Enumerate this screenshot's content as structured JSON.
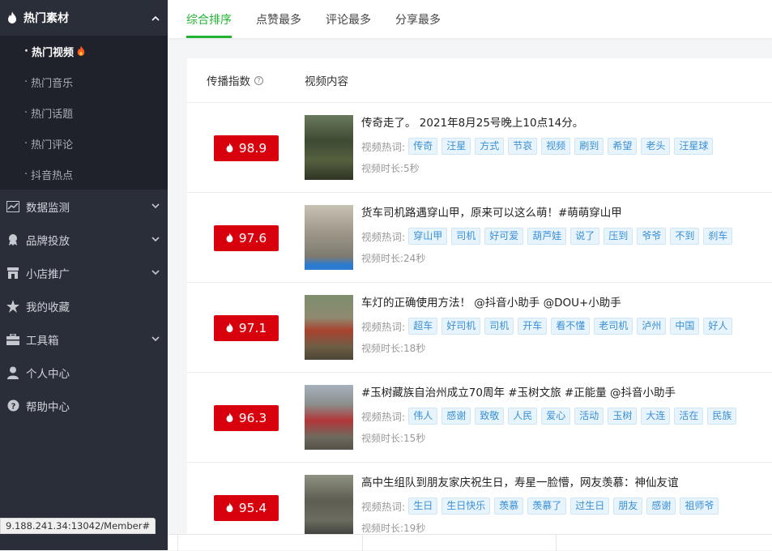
{
  "sidebar": {
    "section": {
      "label": "热门素材"
    },
    "sub_items": [
      {
        "label": "热门视频",
        "active": true
      },
      {
        "label": "热门音乐",
        "active": false
      },
      {
        "label": "热门话题",
        "active": false
      },
      {
        "label": "热门评论",
        "active": false
      },
      {
        "label": "抖音热点",
        "active": false
      }
    ],
    "menu_items": [
      {
        "label": "数据监测",
        "icon": "chart-icon",
        "expandable": true
      },
      {
        "label": "品牌投放",
        "icon": "award-icon",
        "expandable": true
      },
      {
        "label": "小店推广",
        "icon": "shop-icon",
        "expandable": true
      },
      {
        "label": "我的收藏",
        "icon": "star-icon",
        "expandable": false
      },
      {
        "label": "工具箱",
        "icon": "toolbox-icon",
        "expandable": true
      },
      {
        "label": "个人中心",
        "icon": "user-icon",
        "expandable": false
      },
      {
        "label": "帮助中心",
        "icon": "help-icon",
        "expandable": false
      }
    ]
  },
  "status_url": "9.188.241.34:13042/Member#",
  "tabs": [
    "综合排序",
    "点赞最多",
    "评论最多",
    "分享最多"
  ],
  "table": {
    "col_score": "传播指数",
    "col_content": "视频内容",
    "tags_label": "视频热词:",
    "duration_label": "视频时长:",
    "rows": [
      {
        "score": "98.9",
        "title": "传奇走了。 2021年8月25号晚上10点14分。",
        "tags": [
          "传奇",
          "汪星",
          "方式",
          "节哀",
          "视频",
          "刷到",
          "希望",
          "老头",
          "汪星球"
        ],
        "duration": "5秒"
      },
      {
        "score": "97.6",
        "title": "货车司机路遇穿山甲，原来可以这么萌！#萌萌穿山甲",
        "tags": [
          "穿山甲",
          "司机",
          "好可爱",
          "葫芦娃",
          "说了",
          "压到",
          "爷爷",
          "不到",
          "刹车"
        ],
        "duration": "24秒"
      },
      {
        "score": "97.1",
        "title": "车灯的正确使用方法！ @抖音小助手 @DOU+小助手",
        "tags": [
          "超车",
          "好司机",
          "司机",
          "开车",
          "看不懂",
          "老司机",
          "泸州",
          "中国",
          "好人"
        ],
        "duration": "18秒"
      },
      {
        "score": "96.3",
        "title": "#玉树藏族自治州成立70周年 #玉树文旅 #正能量 @抖音小助手",
        "tags": [
          "伟人",
          "感谢",
          "致敬",
          "人民",
          "爱心",
          "活动",
          "玉树",
          "大连",
          "活在",
          "民族"
        ],
        "duration": "15秒"
      },
      {
        "score": "95.4",
        "title": "高中生组队到朋友家庆祝生日，寿星一脸懵，网友羡慕：神仙友谊",
        "tags": [
          "生日",
          "生日快乐",
          "羡慕",
          "羡慕了",
          "过生日",
          "朋友",
          "感谢",
          "祖师爷"
        ],
        "duration": "19秒"
      }
    ]
  },
  "colors": {
    "accent": "#21b331",
    "score_bg": "#d9000e",
    "sidebar_bg": "#2a2e38",
    "tag_text": "#3a8fd6"
  }
}
